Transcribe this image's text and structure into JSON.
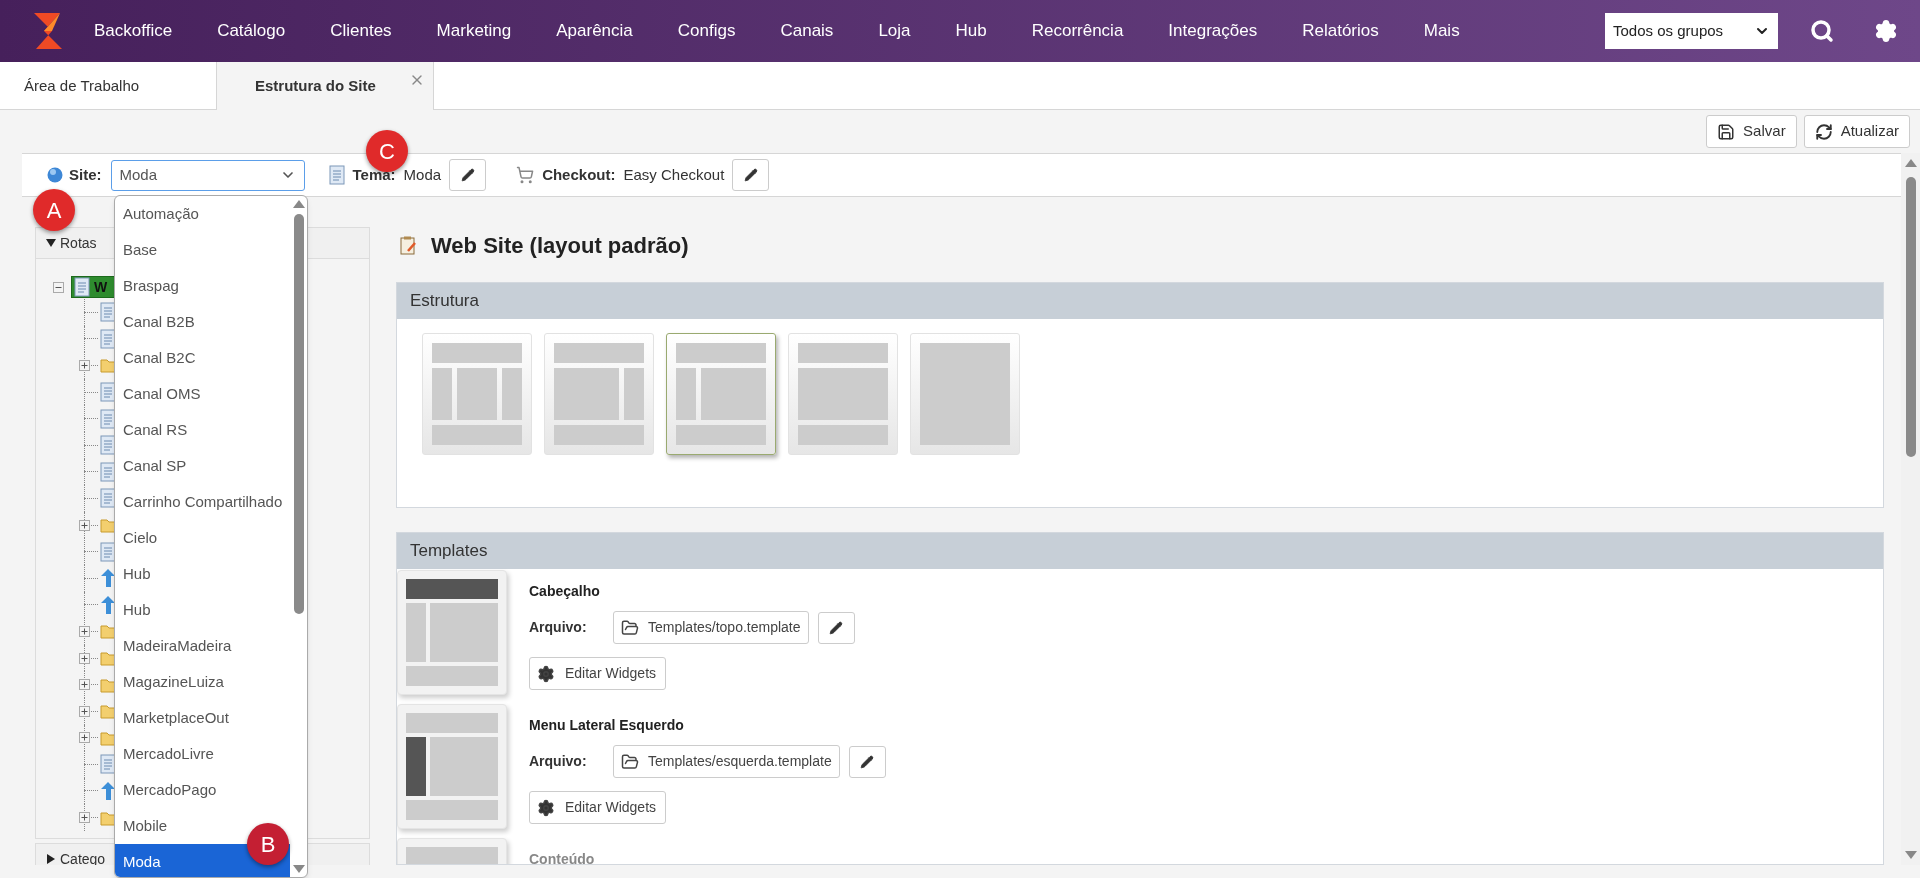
{
  "nav": {
    "items": [
      "Backoffice",
      "Catálogo",
      "Clientes",
      "Marketing",
      "Aparência",
      "Configs",
      "Canais",
      "Loja",
      "Hub",
      "Recorrência",
      "Integrações",
      "Relatórios",
      "Mais"
    ],
    "group_select": "Todos os grupos"
  },
  "tabs": [
    {
      "label": "Área de Trabalho",
      "selected": false,
      "closable": false
    },
    {
      "label": "Estrutura do Site",
      "selected": true,
      "closable": true
    }
  ],
  "toolbar": {
    "buttons": [
      {
        "kind": "save",
        "label": "Salvar"
      },
      {
        "kind": "refresh",
        "label": "Atualizar"
      }
    ]
  },
  "site_bar": {
    "site_label": "Site:",
    "site_value": "Moda",
    "theme_label": "Tema:",
    "theme_value": "Moda",
    "checkout_label": "Checkout:",
    "checkout_value": "Easy Checkout"
  },
  "site_dropdown": {
    "options": [
      {
        "label": "Automação",
        "selected": false
      },
      {
        "label": "Base",
        "selected": false
      },
      {
        "label": "Braspag",
        "selected": false
      },
      {
        "label": "Canal B2B",
        "selected": false
      },
      {
        "label": "Canal B2C",
        "selected": false
      },
      {
        "label": "Canal OMS",
        "selected": false
      },
      {
        "label": "Canal RS",
        "selected": false
      },
      {
        "label": "Canal SP",
        "selected": false
      },
      {
        "label": "Carrinho Compartilhado",
        "selected": false
      },
      {
        "label": "Cielo",
        "selected": false
      },
      {
        "label": "Hub",
        "selected": false
      },
      {
        "label": "Hub",
        "selected": false
      },
      {
        "label": "MadeiraMadeira",
        "selected": false
      },
      {
        "label": "MagazineLuiza",
        "selected": false
      },
      {
        "label": "MarketplaceOut",
        "selected": false
      },
      {
        "label": "MercadoLivre",
        "selected": false
      },
      {
        "label": "MercadoPago",
        "selected": false
      },
      {
        "label": "Mobile",
        "selected": false
      },
      {
        "label": "Moda",
        "selected": true
      }
    ]
  },
  "sidebar": {
    "sections": [
      {
        "label": "Rotas",
        "expanded": true
      },
      {
        "label": "Catego",
        "expanded": false
      }
    ],
    "tree": {
      "label": "W",
      "expanded": true,
      "children": [
        {
          "kind": "page"
        },
        {
          "kind": "page"
        },
        {
          "kind": "folder",
          "expanded": false
        },
        {
          "kind": "page"
        },
        {
          "kind": "page"
        },
        {
          "kind": "page"
        },
        {
          "kind": "page"
        },
        {
          "kind": "page"
        },
        {
          "kind": "folder",
          "expanded": false
        },
        {
          "kind": "page"
        },
        {
          "kind": "redirect"
        },
        {
          "kind": "redirect"
        },
        {
          "kind": "folder",
          "expanded": false
        },
        {
          "kind": "folder",
          "expanded": false
        },
        {
          "kind": "folder",
          "expanded": false
        },
        {
          "kind": "folder",
          "expanded": false
        },
        {
          "kind": "folder",
          "expanded": false
        },
        {
          "kind": "page"
        },
        {
          "kind": "redirect"
        },
        {
          "kind": "folder",
          "expanded": false
        }
      ]
    }
  },
  "main": {
    "title": "Web Site (layout padrão)",
    "structure": {
      "title": "Estrutura",
      "layouts": [
        {
          "kind": "three-column",
          "selected": false
        },
        {
          "kind": "right-sidebar",
          "selected": false
        },
        {
          "kind": "left-sidebar",
          "selected": true
        },
        {
          "kind": "single",
          "selected": false
        },
        {
          "kind": "full",
          "selected": false
        }
      ]
    },
    "templates": {
      "title": "Templates",
      "items": [
        {
          "name": "Cabeçalho",
          "kind": "top",
          "disabled": false,
          "file_label": "Arquivo:",
          "file": "Templates/topo.template",
          "widgets_button": "Editar Widgets"
        },
        {
          "name": "Menu Lateral Esquerdo",
          "kind": "left",
          "disabled": false,
          "file_label": "Arquivo:",
          "file": "Templates/esquerda.template",
          "widgets_button": "Editar Widgets"
        },
        {
          "name": "Conteúdo",
          "kind": "center",
          "disabled": true
        }
      ]
    }
  },
  "annotations": [
    {
      "label": "A"
    },
    {
      "label": "B"
    },
    {
      "label": "C"
    }
  ]
}
